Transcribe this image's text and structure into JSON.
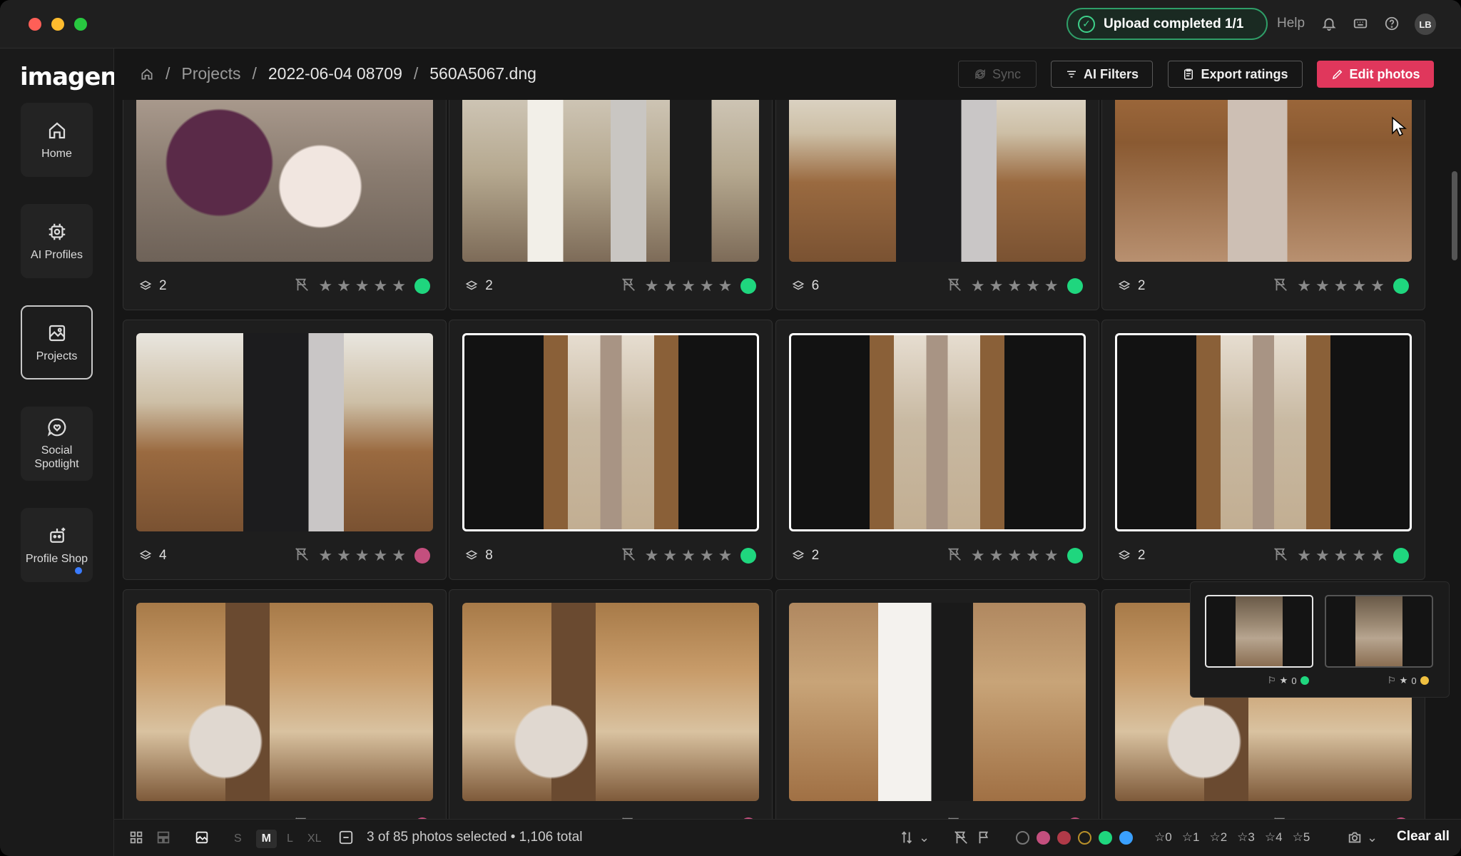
{
  "window": {
    "traffic": [
      "#ff5f57",
      "#febc2e",
      "#28c840"
    ]
  },
  "titlebar": {
    "upload_status": "Upload completed 1/1",
    "help": "Help",
    "avatar": "LB",
    "icons": [
      "bell-icon",
      "keyboard-icon",
      "help-circle-icon"
    ]
  },
  "sidebar": {
    "logo": "imagen",
    "items": [
      {
        "label": "Home",
        "icon": "home-icon"
      },
      {
        "label": "AI Profiles",
        "icon": "chip-icon"
      },
      {
        "label": "Projects",
        "icon": "gallery-icon",
        "active": true
      },
      {
        "label": "Social Spotlight",
        "icon": "heart-bubble-icon"
      },
      {
        "label": "Profile Shop",
        "icon": "robot-icon",
        "badge": true
      }
    ]
  },
  "header": {
    "breadcrumb": [
      "Projects",
      "2022-06-04 08709",
      "560A5067.dng"
    ],
    "sync": "Sync",
    "ai_filters": "AI Filters",
    "export_ratings": "Export ratings",
    "edit_photos": "Edit photos"
  },
  "photos": [
    {
      "stack": "2",
      "color": "#1fd67e",
      "scene": "flowers",
      "selected": false
    },
    {
      "stack": "2",
      "color": "#1fd67e",
      "scene": "church",
      "selected": false
    },
    {
      "stack": "6",
      "color": "#1fd67e",
      "scene": "hug",
      "selected": false
    },
    {
      "stack": "2",
      "color": "#1fd67e",
      "scene": "dress",
      "selected": false
    },
    {
      "stack": "4",
      "color": "#c44f7e",
      "scene": "hug",
      "selected": false
    },
    {
      "stack": "8",
      "color": "#1fd67e",
      "scene": "aisle",
      "selected": true
    },
    {
      "stack": "2",
      "color": "#1fd67e",
      "scene": "aisle",
      "selected": true
    },
    {
      "stack": "2",
      "color": "#1fd67e",
      "scene": "aisle",
      "selected": true
    },
    {
      "stack": "",
      "color": "#c44f7e",
      "scene": "altar",
      "selected": false
    },
    {
      "stack": "",
      "color": "#c44f7e",
      "scene": "altar",
      "selected": false
    },
    {
      "stack": "",
      "color": "#c44f7e",
      "scene": "vows",
      "selected": false
    },
    {
      "stack": "",
      "color": "#c44f7e",
      "scene": "altar",
      "selected": false
    }
  ],
  "popup": {
    "items": [
      {
        "stars": "0",
        "color": "#1fd67e",
        "selected": true
      },
      {
        "stars": "0",
        "color": "#f0c040",
        "selected": false
      }
    ]
  },
  "bottom": {
    "sizes": [
      "S",
      "M",
      "L",
      "XL"
    ],
    "active_size": "M",
    "selection": "3 of 85 photos selected • 1,106 total",
    "color_filters": [
      "#1a1a1a",
      "#c44f7e",
      "#b03a48",
      "#1a1a1a",
      "#1fd67e",
      "#3aa0ff"
    ],
    "star_filters": [
      "0",
      "1",
      "2",
      "3",
      "4",
      "5"
    ],
    "clear_all": "Clear all"
  }
}
